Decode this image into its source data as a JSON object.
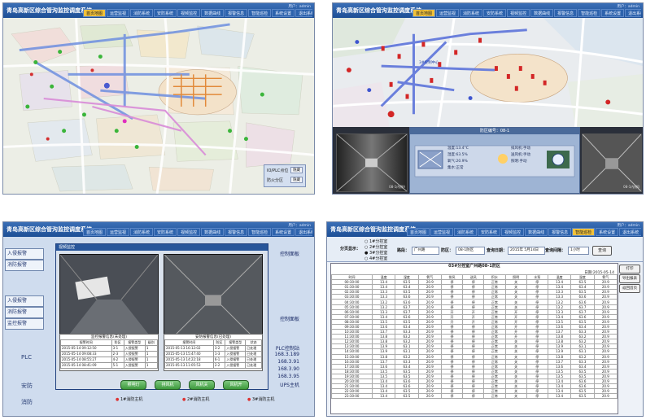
{
  "app_title": "青岛高新区综合管沟监控调度系统",
  "user_line": "用户：admin",
  "tabs": [
    "首页地图",
    "运营监视",
    "消防系统",
    "安防系统",
    "视频监控",
    "数据曲线",
    "报警信息",
    "智能巡检",
    "系统设置",
    "退出系统"
  ],
  "active_tab_tl": 0,
  "active_tab_tr": 0,
  "active_tab_br": 7,
  "map_legend": {
    "row1_label": "IO/PLC点位",
    "row1_btn": "隐藏",
    "row2_label": "防火分区",
    "row2_btn": "隐藏"
  },
  "map_labels": {
    "tr_marker": "3#控制中心"
  },
  "tr_detail": {
    "header": "防区编号：08-1",
    "left_stats": [
      "温度:13.4°C",
      "湿度:63.5%",
      "氧气:20.9%",
      "集水:正常"
    ],
    "right_stats": [
      "排风机:手动",
      "送风机:手动",
      "照明:手动"
    ]
  },
  "tr_cams": [
    "08-1内侧A",
    "08-1内侧B"
  ],
  "bl_side": [
    "入侵报警",
    "消防报警",
    "入侵报警",
    "消防报警",
    "监控报警"
  ],
  "bl_side2": [
    "PLC",
    "安防",
    "消防"
  ],
  "bl_popup": {
    "title": "视频监控",
    "video1_caption": "2015-05-14 安全出口",
    "video2_caption": "2015-05-14 防区3-1",
    "table1": {
      "title": "监控报警信息(未处理)",
      "head": [
        "报警时间",
        "防区",
        "报警类型",
        "级别"
      ],
      "rows": [
        [
          "2015-05-14 09:12:50",
          "3-1",
          "入侵报警",
          "1"
        ],
        [
          "2015-05-14 09:08:33",
          "2-3",
          "入侵报警",
          "1"
        ],
        [
          "2015-05-14 08:55:27",
          "4-2",
          "入侵报警",
          "1"
        ],
        [
          "2015-05-14 08:41:09",
          "5-1",
          "入侵报警",
          "1"
        ]
      ]
    },
    "table2": {
      "title": "安防报警信息(已处理)",
      "head": [
        "报警时间",
        "防区",
        "报警类型",
        "状态"
      ],
      "rows": [
        [
          "2015-05-13 16:12:02",
          "3-2",
          "入侵报警",
          "已处理"
        ],
        [
          "2015-05-13 15:47:40",
          "1-3",
          "入侵报警",
          "已处理"
        ],
        [
          "2015-05-13 14:22:18",
          "6-1",
          "入侵报警",
          "已处理"
        ],
        [
          "2015-05-13 11:05:53",
          "2-2",
          "入侵报警",
          "已处理"
        ]
      ]
    },
    "buttons": [
      "照明灯",
      "排风机",
      "风机关",
      "风机开"
    ]
  },
  "bl_right_notes": [
    "控制面板",
    "控制面板",
    "PLC控制站",
    "168.3.189",
    "168.3.91",
    "168.3.90",
    "168.3.95",
    "UPS主机"
  ],
  "bl_legend": [
    "1#消防主机",
    "2#消防主机",
    "3#消防主机"
  ],
  "br_filter": {
    "mode_label": "分页显示：",
    "modes": [
      "1#分控室",
      "2#分控室",
      "3#分控室",
      "4#分控室"
    ],
    "area_label": "路段：",
    "area_val": "广州路",
    "zone_label": "防区：",
    "zone_val": "08-1防区",
    "date_label": "查询日期：",
    "date_val": "2015年 5月14日",
    "period_label": "查询间隔：",
    "period_val": "1小时",
    "query_btn": "查询",
    "side_btns": [
      "打印",
      "导出报表",
      "返回首页"
    ]
  },
  "br_report": {
    "title": "03#分控室广州路08-1防区",
    "date": "日期:2015-05-14",
    "groups": [
      "温度检测",
      "湿度检测",
      "氧气检测",
      "排风风机",
      "送风风机",
      "积水检测",
      "照明",
      "水泵",
      "温度",
      "湿度",
      "氧气"
    ],
    "rows": [
      [
        "00:30:00",
        "13.4",
        "63.5",
        "20.9",
        "停",
        "停",
        "正常",
        "关",
        "停",
        "13.4",
        "63.5",
        "20.9"
      ],
      [
        "01:30:00",
        "13.4",
        "63.4",
        "20.9",
        "停",
        "停",
        "正常",
        "关",
        "停",
        "13.4",
        "63.4",
        "20.9"
      ],
      [
        "02:30:00",
        "13.3",
        "63.5",
        "20.9",
        "停",
        "停",
        "正常",
        "关",
        "停",
        "13.3",
        "63.5",
        "20.9"
      ],
      [
        "03:30:00",
        "13.3",
        "63.6",
        "20.9",
        "停",
        "停",
        "正常",
        "关",
        "停",
        "13.3",
        "63.6",
        "20.9"
      ],
      [
        "04:30:00",
        "13.2",
        "63.6",
        "20.9",
        "停",
        "停",
        "正常",
        "关",
        "停",
        "13.2",
        "63.6",
        "20.9"
      ],
      [
        "05:30:00",
        "13.2",
        "63.7",
        "20.9",
        "停",
        "停",
        "正常",
        "关",
        "停",
        "13.2",
        "63.7",
        "20.9"
      ],
      [
        "06:30:00",
        "13.3",
        "63.7",
        "20.9",
        "开",
        "开",
        "正常",
        "开",
        "停",
        "13.3",
        "63.7",
        "20.9"
      ],
      [
        "07:30:00",
        "13.4",
        "63.6",
        "20.9",
        "开",
        "开",
        "正常",
        "开",
        "停",
        "13.4",
        "63.6",
        "20.9"
      ],
      [
        "08:30:00",
        "13.5",
        "63.5",
        "20.9",
        "开",
        "开",
        "正常",
        "开",
        "停",
        "13.5",
        "63.5",
        "20.9"
      ],
      [
        "09:30:00",
        "13.6",
        "63.4",
        "20.9",
        "停",
        "停",
        "正常",
        "开",
        "停",
        "13.6",
        "63.4",
        "20.9"
      ],
      [
        "10:30:00",
        "13.7",
        "63.3",
        "20.9",
        "停",
        "停",
        "正常",
        "开",
        "停",
        "13.7",
        "63.3",
        "20.9"
      ],
      [
        "11:30:00",
        "13.8",
        "63.2",
        "20.9",
        "停",
        "停",
        "正常",
        "开",
        "停",
        "13.8",
        "63.2",
        "20.9"
      ],
      [
        "12:30:00",
        "13.8",
        "63.2",
        "20.9",
        "停",
        "停",
        "正常",
        "关",
        "停",
        "13.8",
        "63.2",
        "20.9"
      ],
      [
        "13:30:00",
        "13.9",
        "63.1",
        "20.9",
        "停",
        "停",
        "正常",
        "关",
        "停",
        "13.9",
        "63.1",
        "20.9"
      ],
      [
        "14:30:00",
        "13.9",
        "63.1",
        "20.9",
        "停",
        "停",
        "正常",
        "关",
        "停",
        "13.9",
        "63.1",
        "20.9"
      ],
      [
        "15:30:00",
        "13.8",
        "63.2",
        "20.9",
        "停",
        "停",
        "正常",
        "关",
        "停",
        "13.8",
        "63.2",
        "20.9"
      ],
      [
        "16:30:00",
        "13.7",
        "63.3",
        "20.9",
        "停",
        "停",
        "正常",
        "关",
        "停",
        "13.7",
        "63.3",
        "20.9"
      ],
      [
        "17:30:00",
        "13.6",
        "63.4",
        "20.9",
        "停",
        "停",
        "正常",
        "关",
        "停",
        "13.6",
        "63.4",
        "20.9"
      ],
      [
        "18:30:00",
        "13.5",
        "63.5",
        "20.9",
        "停",
        "停",
        "正常",
        "关",
        "停",
        "13.5",
        "63.5",
        "20.9"
      ],
      [
        "19:30:00",
        "13.5",
        "63.5",
        "20.9",
        "停",
        "停",
        "正常",
        "关",
        "停",
        "13.5",
        "63.5",
        "20.9"
      ],
      [
        "20:30:00",
        "13.4",
        "63.6",
        "20.9",
        "停",
        "停",
        "正常",
        "关",
        "停",
        "13.4",
        "63.6",
        "20.9"
      ],
      [
        "21:30:00",
        "13.4",
        "63.6",
        "20.9",
        "停",
        "停",
        "正常",
        "关",
        "停",
        "13.4",
        "63.6",
        "20.9"
      ],
      [
        "22:30:00",
        "13.4",
        "63.5",
        "20.9",
        "停",
        "停",
        "正常",
        "关",
        "停",
        "13.4",
        "63.5",
        "20.9"
      ],
      [
        "23:30:00",
        "13.4",
        "63.5",
        "20.9",
        "停",
        "停",
        "正常",
        "关",
        "停",
        "13.4",
        "63.5",
        "20.9"
      ]
    ],
    "head2": [
      "时间",
      "温度",
      "湿度",
      "氧气",
      "排风",
      "送风",
      "积水",
      "照明",
      "水泵",
      "温度",
      "湿度",
      "氧气"
    ]
  }
}
